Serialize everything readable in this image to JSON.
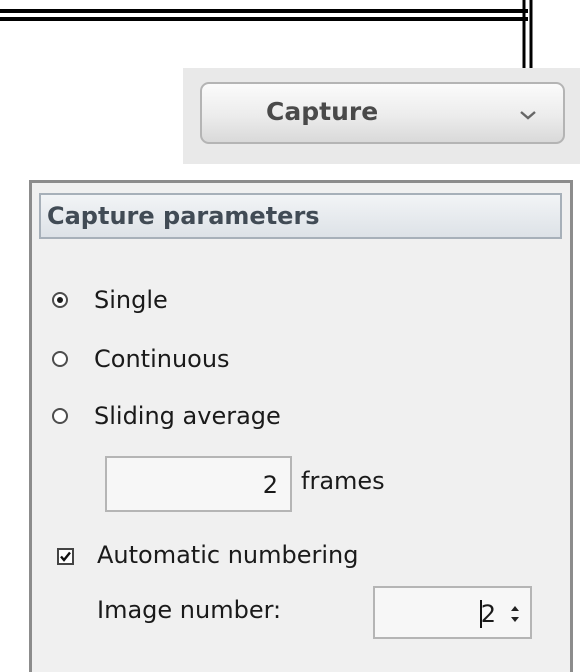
{
  "capture_button": {
    "label": "Capture",
    "dropdown_icon": "chevron-down-icon"
  },
  "panel": {
    "title": "Capture parameters",
    "modes": [
      {
        "label": "Single",
        "selected": true
      },
      {
        "label": "Continuous",
        "selected": false
      },
      {
        "label": "Sliding average",
        "selected": false
      }
    ],
    "frames": {
      "value": "2",
      "unit": "frames"
    },
    "automatic_numbering": {
      "label": "Automatic numbering",
      "checked": true
    },
    "image_number": {
      "label": "Image number:",
      "value": "2"
    }
  }
}
